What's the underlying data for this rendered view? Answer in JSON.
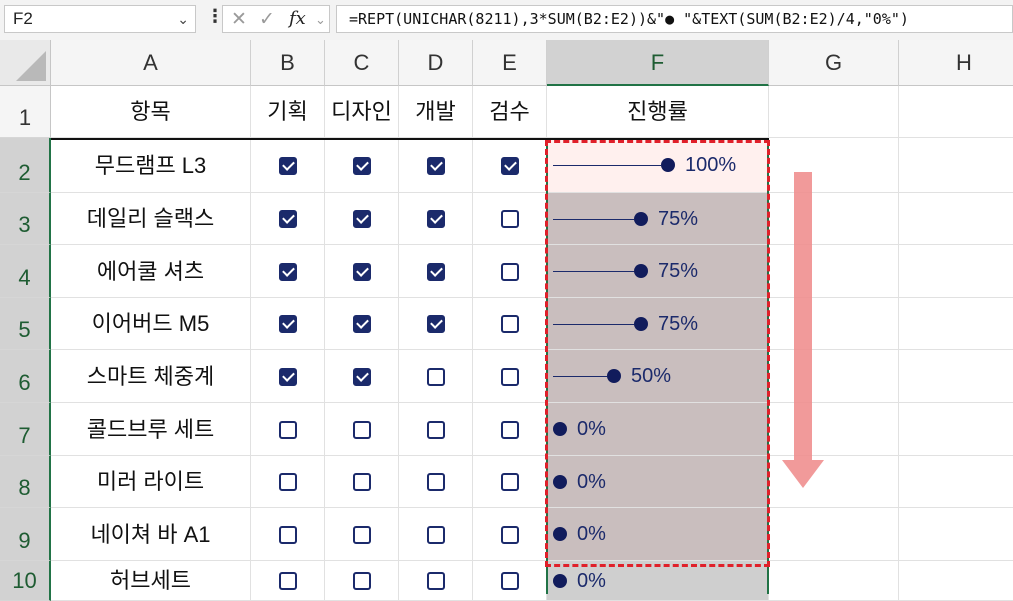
{
  "formula_bar": {
    "name_box": "F2",
    "formula": "=REPT(UNICHAR(8211),3*SUM(B2:E2))&\"● \"&TEXT(SUM(B2:E2)/4,\"0%\")"
  },
  "columns": [
    "A",
    "B",
    "C",
    "D",
    "E",
    "F",
    "G",
    "H"
  ],
  "header_row": {
    "row_number": "1",
    "item": "항목",
    "plan": "기획",
    "design": "디자인",
    "dev": "개발",
    "review": "검수",
    "progress": "진행률"
  },
  "rows": [
    {
      "row_number": "2",
      "item": "무드램프 L3",
      "checks": [
        true,
        true,
        true,
        true
      ],
      "progress": 1.0,
      "progress_text": "100%"
    },
    {
      "row_number": "3",
      "item": "데일리 슬랙스",
      "checks": [
        true,
        true,
        true,
        false
      ],
      "progress": 0.75,
      "progress_text": "75%"
    },
    {
      "row_number": "4",
      "item": "에어쿨 셔츠",
      "checks": [
        true,
        true,
        true,
        false
      ],
      "progress": 0.75,
      "progress_text": "75%"
    },
    {
      "row_number": "5",
      "item": "이어버드 M5",
      "checks": [
        true,
        true,
        true,
        false
      ],
      "progress": 0.75,
      "progress_text": "75%"
    },
    {
      "row_number": "6",
      "item": "스마트 체중계",
      "checks": [
        true,
        true,
        false,
        false
      ],
      "progress": 0.5,
      "progress_text": "50%"
    },
    {
      "row_number": "7",
      "item": "콜드브루 세트",
      "checks": [
        false,
        false,
        false,
        false
      ],
      "progress": 0,
      "progress_text": "0%"
    },
    {
      "row_number": "8",
      "item": "미러 라이트",
      "checks": [
        false,
        false,
        false,
        false
      ],
      "progress": 0,
      "progress_text": "0%"
    },
    {
      "row_number": "9",
      "item": "네이쳐 바 A1",
      "checks": [
        false,
        false,
        false,
        false
      ],
      "progress": 0,
      "progress_text": "0%"
    },
    {
      "row_number": "10",
      "item": "허브세트",
      "checks": [
        false,
        false,
        false,
        false
      ],
      "progress": 0,
      "progress_text": "0%"
    }
  ],
  "colors": {
    "accent": "#217346",
    "checkbox": "#1b2a6b",
    "dashed_highlight": "#e0202a",
    "arrow": "#ef8f8f"
  }
}
